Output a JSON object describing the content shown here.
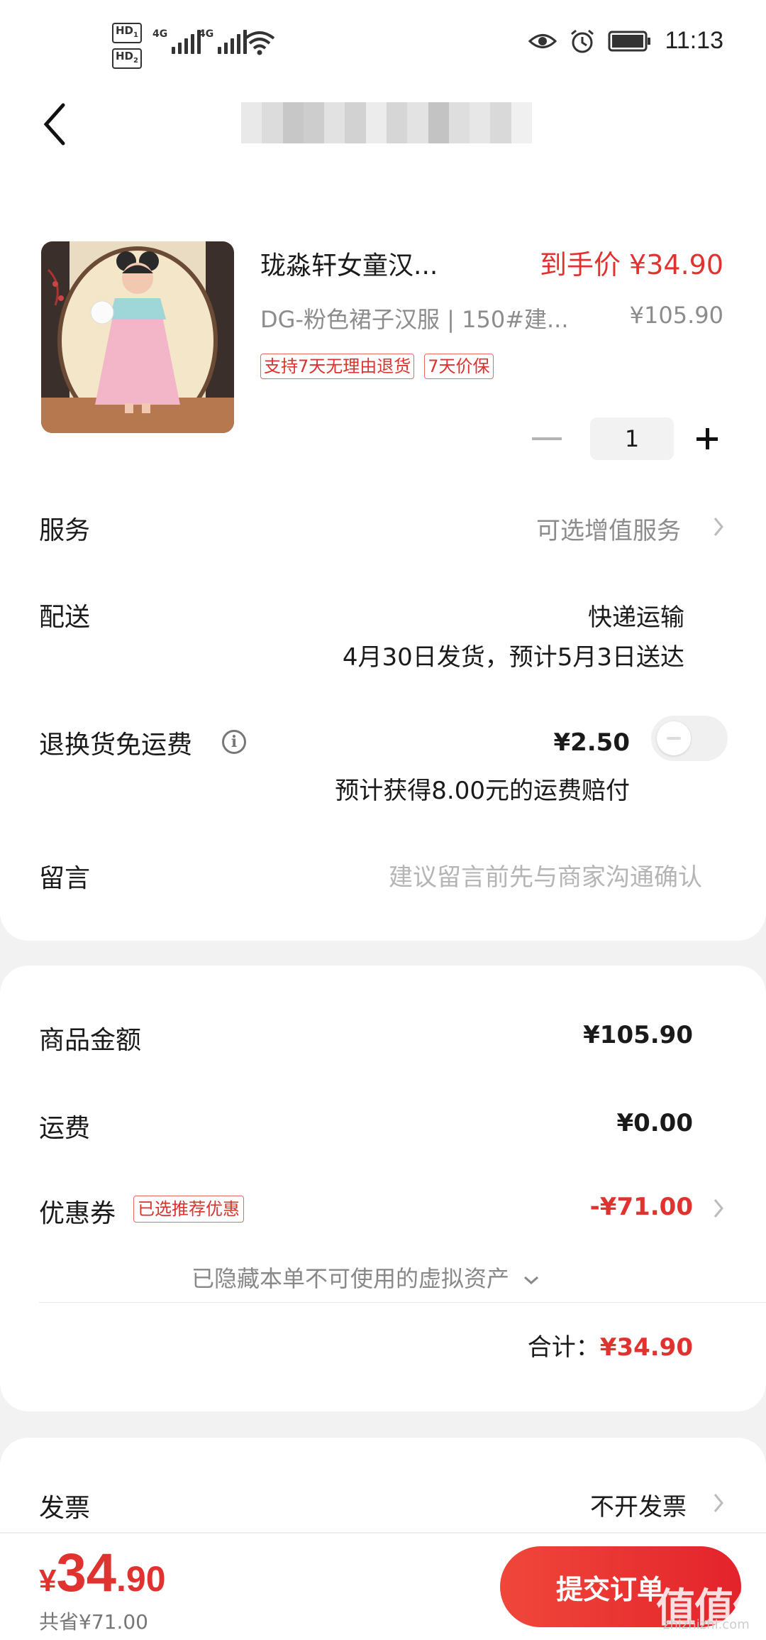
{
  "status_bar": {
    "sim1": "HD",
    "sim1_index": "1",
    "sim2": "HD",
    "sim2_index": "2",
    "network1": "4G",
    "network2": "4G",
    "time": "11:13"
  },
  "product": {
    "name": "珑淼轩女童汉...",
    "price_label": "到手价 ¥34.90",
    "sku": "DG-粉色裙子汉服 | 150#建...",
    "original_price": "¥105.90",
    "badges": [
      "支持7天无理由退货",
      "7天价保"
    ],
    "quantity": "1"
  },
  "service": {
    "label": "服务",
    "value": "可选增值服务"
  },
  "delivery": {
    "label": "配送",
    "method": "快递运输",
    "eta": "4月30日发货，预计5月3日送达"
  },
  "return_insurance": {
    "label": "退换货免运费",
    "info_glyph": "i",
    "price": "¥2.50",
    "note": "预计获得8.00元的运费赔付",
    "enabled": false
  },
  "message": {
    "label": "留言",
    "placeholder": "建议留言前先与商家沟通确认"
  },
  "summary": {
    "goods_label": "商品金额",
    "goods_value": "¥105.90",
    "shipping_label": "运费",
    "shipping_value": "¥0.00",
    "coupon_label": "优惠券",
    "coupon_badge": "已选推荐优惠",
    "coupon_value": "-¥71.00",
    "hidden_assets": "已隐藏本单不可使用的虚拟资产",
    "total_label": "合计：",
    "total_value": "¥34.90"
  },
  "invoice": {
    "label": "发票",
    "value": "不开发票"
  },
  "bottom_bar": {
    "currency": "¥",
    "total_int": "34",
    "total_dec": ".90",
    "saved": "共省¥71.00",
    "submit_label": "提交订单"
  },
  "watermark": {
    "main": "值值值",
    "sub": "zhizhizhi.com"
  },
  "colors": {
    "accent": "#e0322f",
    "muted": "#8c8c8c",
    "background": "#f2f2f2"
  },
  "icons": {
    "back": "chevron-left-icon",
    "eye": "eye-icon",
    "alarm": "alarm-icon",
    "battery": "battery-icon",
    "wifi": "wifi-icon",
    "info": "info-icon",
    "chevron": "chevron-right-icon"
  }
}
